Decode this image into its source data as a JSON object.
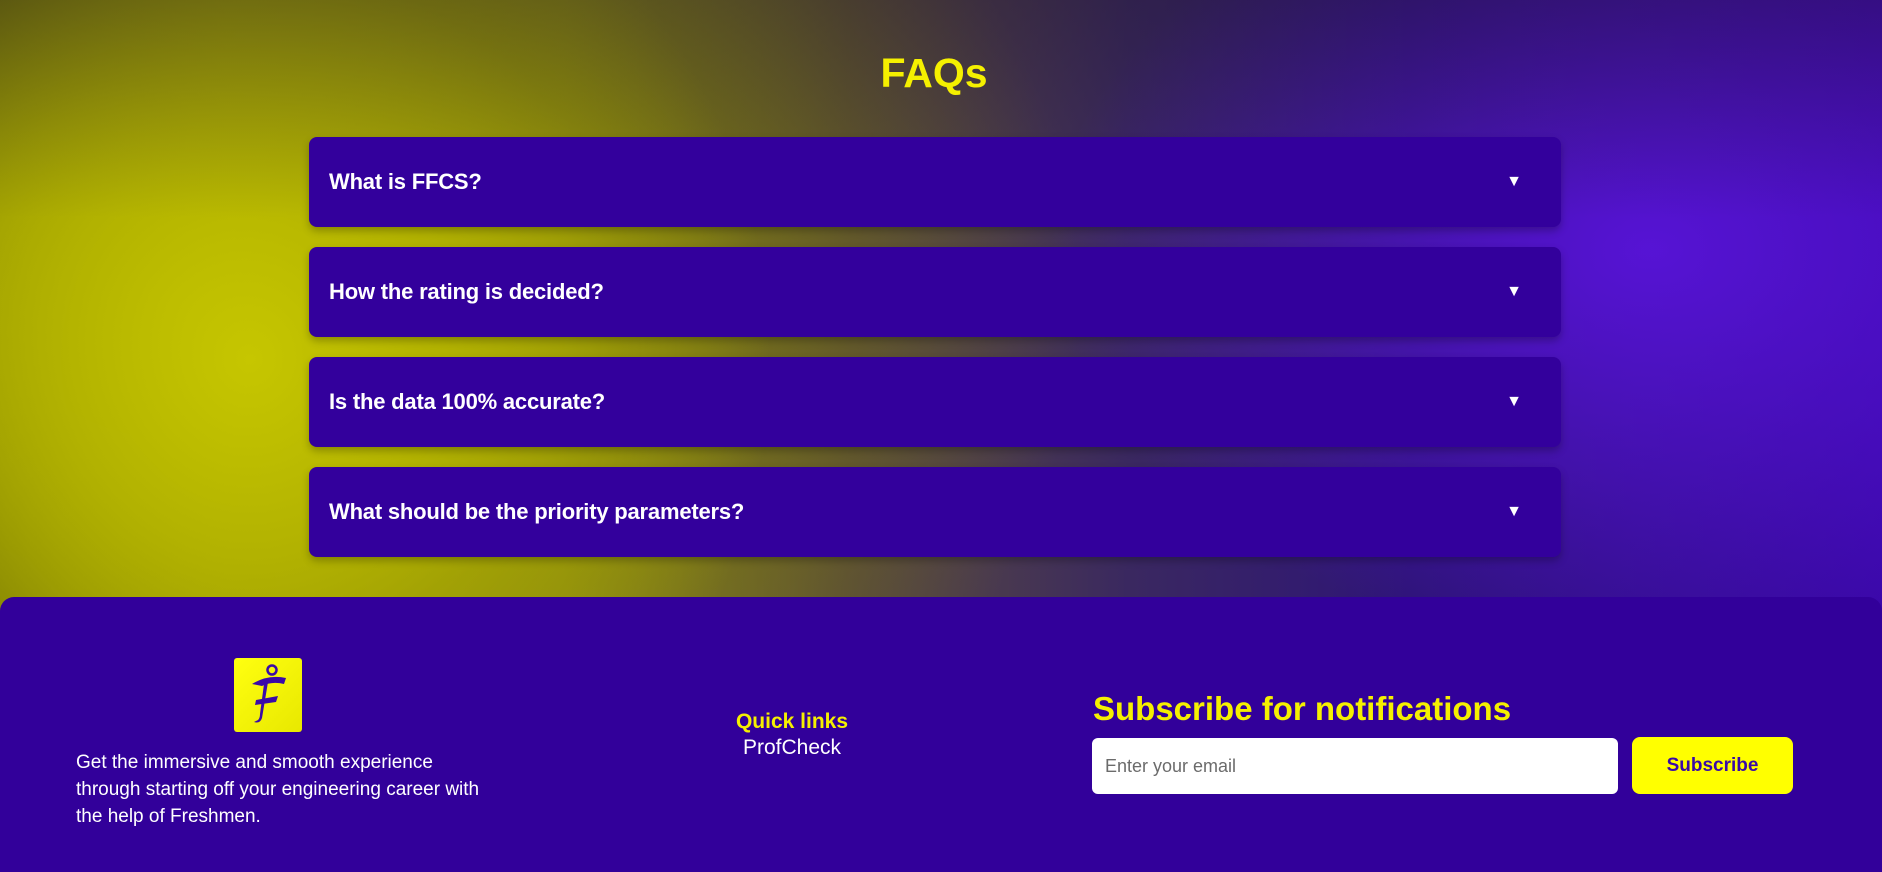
{
  "faq": {
    "title": "FAQs",
    "items": [
      {
        "question": "What is FFCS?"
      },
      {
        "question": "How the rating is decided?"
      },
      {
        "question": "Is the data 100% accurate?"
      },
      {
        "question": "What should be the priority parameters?"
      }
    ]
  },
  "footer": {
    "logo_icon": "freshmen-logo-icon",
    "tagline": "Get the immersive and smooth experience through starting off your engineering career with the help of Freshmen.",
    "quick_links": {
      "title": "Quick links",
      "items": [
        {
          "label": "ProfCheck"
        }
      ]
    },
    "subscribe": {
      "title": "Subscribe for notifications",
      "email_placeholder": "Enter your email",
      "button_label": "Subscribe"
    }
  },
  "colors": {
    "accent_yellow": "#f5f000",
    "primary_purple": "#33009c",
    "button_yellow": "#ffff00",
    "button_text": "#3a0aa8"
  }
}
